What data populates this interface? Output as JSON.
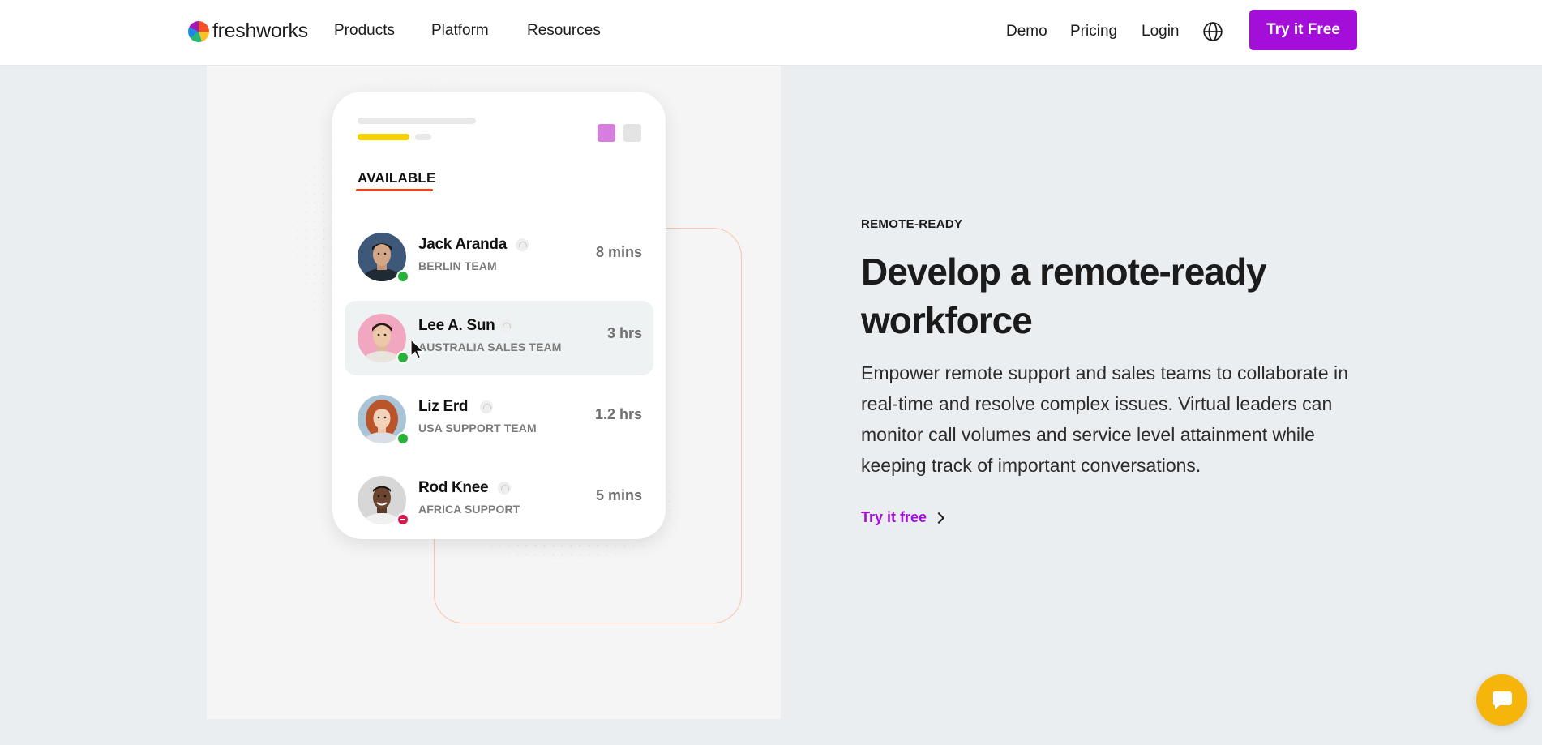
{
  "header": {
    "logo_text": "freshworks",
    "nav": {
      "products": "Products",
      "platform": "Platform",
      "resources": "Resources",
      "demo": "Demo",
      "pricing": "Pricing",
      "login": "Login"
    },
    "cta_label": "Try it Free"
  },
  "illustration": {
    "tab_label": "AVAILABLE",
    "agents": [
      {
        "name": "Jack Aranda",
        "team": "BERLIN TEAM",
        "time": "8 mins",
        "status": "online"
      },
      {
        "name": "Lee A. Sun",
        "team": "AUSTRALIA SALES TEAM",
        "time": "3 hrs",
        "status": "online"
      },
      {
        "name": "Liz Erd",
        "team": "USA SUPPORT TEAM",
        "time": "1.2 hrs",
        "status": "online"
      },
      {
        "name": "Rod Knee",
        "team": "AFRICA SUPPORT",
        "time": "5 mins",
        "status": "busy"
      }
    ]
  },
  "content": {
    "eyebrow": "REMOTE-READY",
    "headline": "Develop a remote-ready workforce",
    "body": "Empower remote support and sales teams to collaborate in real-time and resolve complex issues. Virtual leaders can monitor call volumes and service level attainment while keeping track of important conversations.",
    "link_label": "Try it free"
  },
  "colors": {
    "brand_purple": "#a30fd9",
    "chat_yellow": "#f5b50a",
    "online_green": "#2ab13a",
    "busy_red": "#d41b4c",
    "accent_orange": "#f0421a"
  },
  "icons": [
    "globe-icon",
    "headset-icon",
    "chevron-right-icon",
    "chat-icon",
    "mouse-cursor-icon"
  ]
}
